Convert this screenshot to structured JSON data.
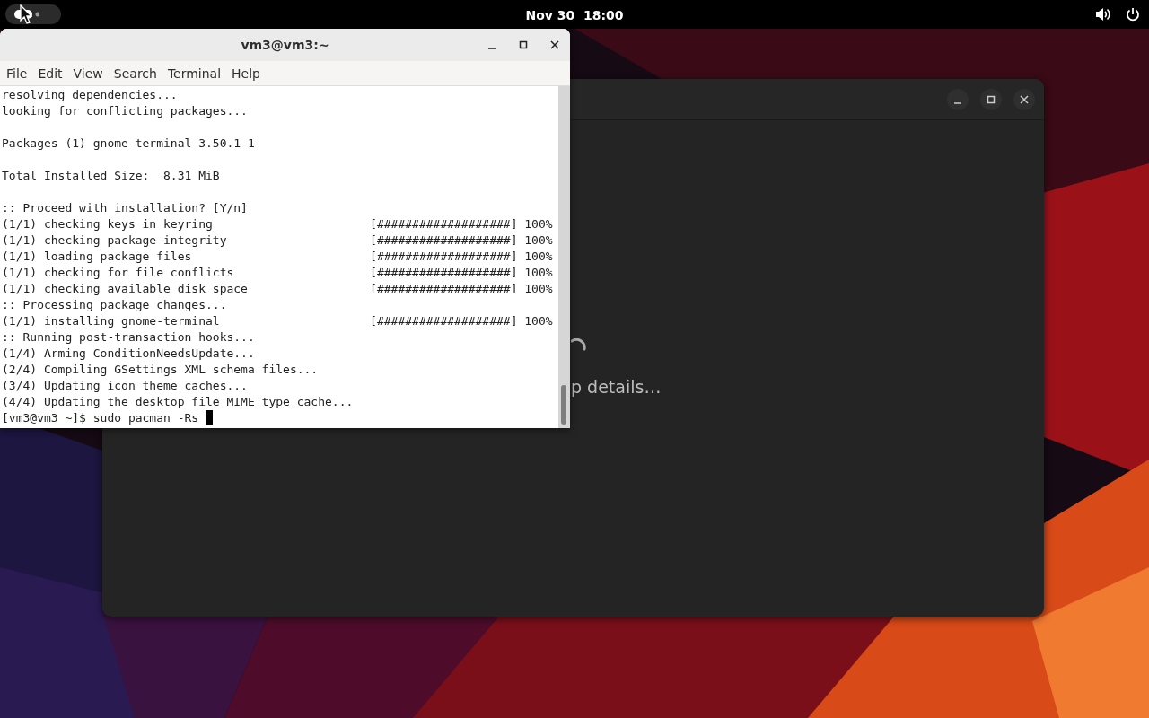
{
  "top_bar": {
    "clock": "Nov 30  18:00"
  },
  "background_window": {
    "status": "p details…"
  },
  "terminal": {
    "title": "vm3@vm3:~",
    "menu": [
      "File",
      "Edit",
      "View",
      "Search",
      "Terminal",
      "Help"
    ],
    "blocks": [
      [
        {
          "text": "resolving dependencies..."
        },
        {
          "text": "looking for conflicting packages..."
        }
      ],
      [
        {
          "text": "Packages (1) gnome-terminal-3.50.1-1"
        }
      ],
      [
        {
          "text": "Total Installed Size:  8.31 MiB"
        }
      ],
      [
        {
          "text": ":: Proceed with installation? [Y/n]"
        },
        {
          "text": "(1/1) checking keys in keyring",
          "progress": "[###################] 100%"
        },
        {
          "text": "(1/1) checking package integrity",
          "progress": "[###################] 100%"
        },
        {
          "text": "(1/1) loading package files",
          "progress": "[###################] 100%"
        },
        {
          "text": "(1/1) checking for file conflicts",
          "progress": "[###################] 100%"
        },
        {
          "text": "(1/1) checking available disk space",
          "progress": "[###################] 100%"
        },
        {
          "text": ":: Processing package changes..."
        },
        {
          "text": "(1/1) installing gnome-terminal",
          "progress": "[###################] 100%"
        },
        {
          "text": ":: Running post-transaction hooks..."
        },
        {
          "text": "(1/4) Arming ConditionNeedsUpdate..."
        },
        {
          "text": "(2/4) Compiling GSettings XML schema files..."
        },
        {
          "text": "(3/4) Updating icon theme caches..."
        },
        {
          "text": "(4/4) Updating the desktop file MIME type cache..."
        }
      ]
    ],
    "prompt": "[vm3@vm3 ~]$ sudo pacman -Rs"
  }
}
